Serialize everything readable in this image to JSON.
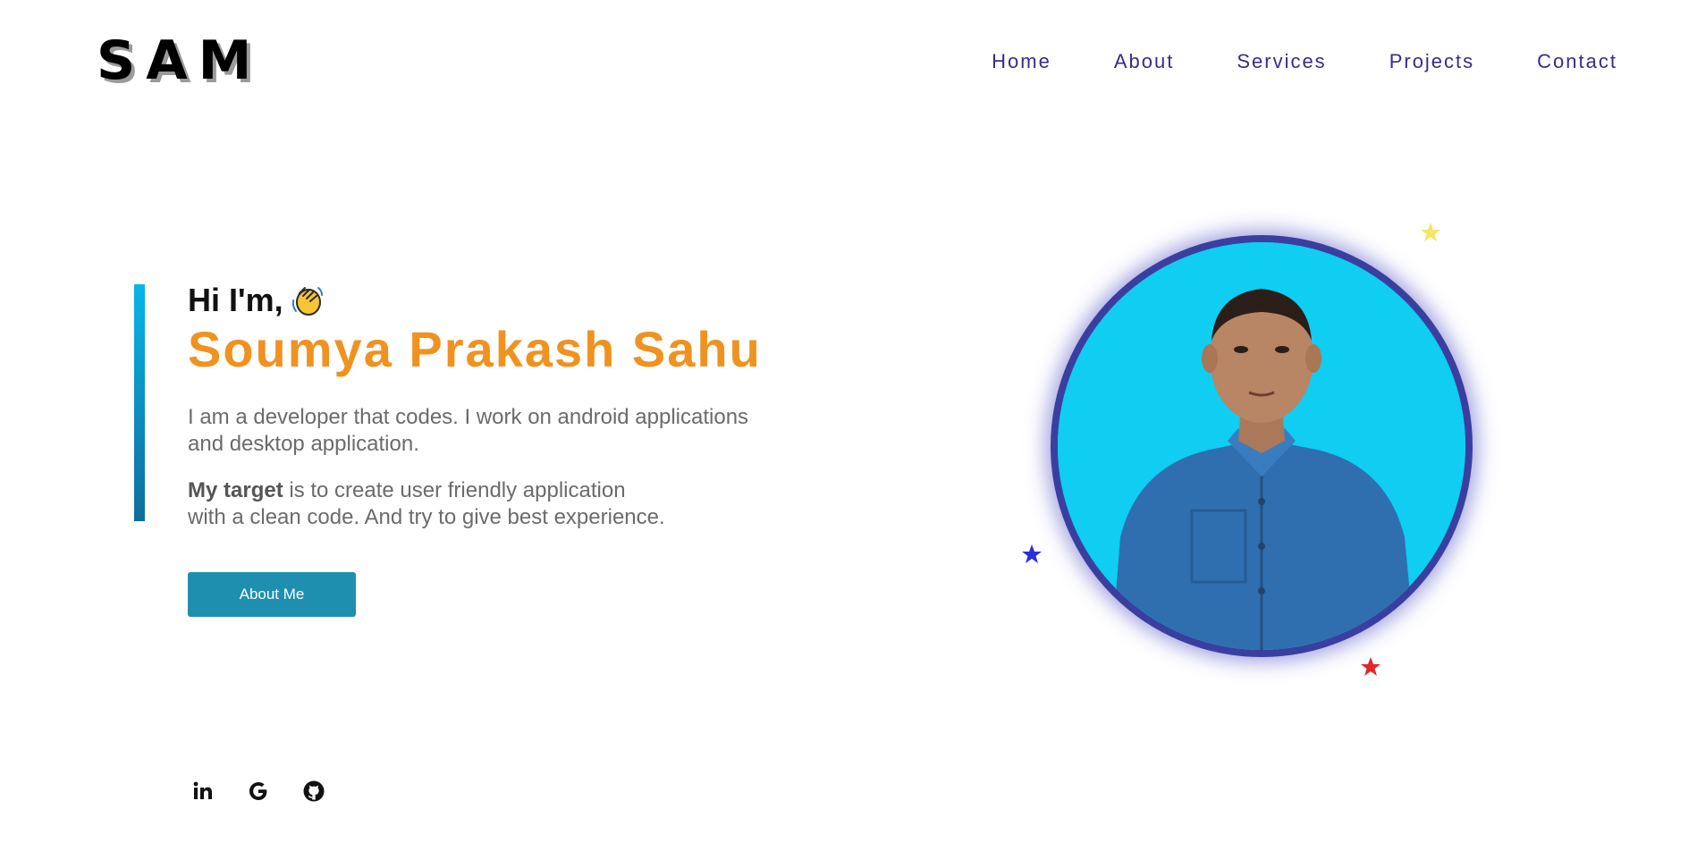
{
  "header": {
    "logo": "SAM",
    "nav": [
      "Home",
      "About",
      "Services",
      "Projects",
      "Contact"
    ]
  },
  "hero": {
    "greeting": "Hi I'm,",
    "name": "Soumya Prakash Sahu",
    "intro_line1": "I am a developer that codes. I work on android applications",
    "intro_line2": "and desktop application.",
    "target_bold": "My target",
    "target_rest1": " is to create user friendly application",
    "target_line2": "with a clean code. And try to give best experience.",
    "button_label": "About Me"
  },
  "social": {
    "icons": [
      "linkedin-icon",
      "google-icon",
      "github-icon"
    ]
  },
  "colors": {
    "accent_orange": "#f0921f",
    "nav_purple": "#3c2a8a",
    "button_teal": "#1f8fb0",
    "portrait_bg": "#10cdf2",
    "star_yellow": "#f5e663",
    "star_blue": "#2b2fd6",
    "star_red": "#e0262c"
  }
}
